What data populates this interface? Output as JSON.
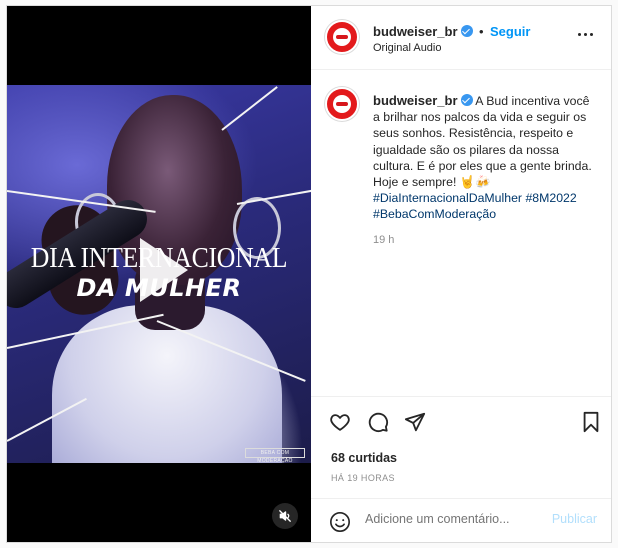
{
  "post": {
    "author": {
      "username": "budweiser_br",
      "verified": true,
      "follow_label": "Seguir",
      "audio_label": "Original Audio"
    },
    "media": {
      "title_line1": "DIA INTERNACIONAL",
      "title_line2": "DA MULHER",
      "tag_chip": "BEBA COM MODERAÇÃO",
      "play_icon": "play-icon",
      "mute_icon": "speaker-muted-icon"
    },
    "caption": {
      "username": "budweiser_br",
      "text": "A Bud incentiva você a brilhar nos palcos da vida e seguir os seus sonhos. Resistência, respeito e igualdade são os pilares da nossa cultura. E é por eles que a gente brinda. Hoje e sempre!",
      "emojis": "🤘🍻",
      "hashtags": [
        "#DiaInternacionalDaMulher",
        "#8M2022",
        "#BebaComModeração"
      ],
      "time_ago": "19 h"
    },
    "actions": {
      "like_icon": "heart-icon",
      "comment_icon": "comment-icon",
      "share_icon": "send-icon",
      "save_icon": "bookmark-icon"
    },
    "likes_text": "68 curtidas",
    "timestamp": "HÁ 19 HORAS",
    "comment": {
      "placeholder": "Adicione um comentário...",
      "publish_label": "Publicar"
    }
  },
  "colors": {
    "brand_red": "#e31a1c",
    "link_blue": "#0095f6",
    "hashtag": "#00376b",
    "muted_text": "#8e8e8e"
  }
}
